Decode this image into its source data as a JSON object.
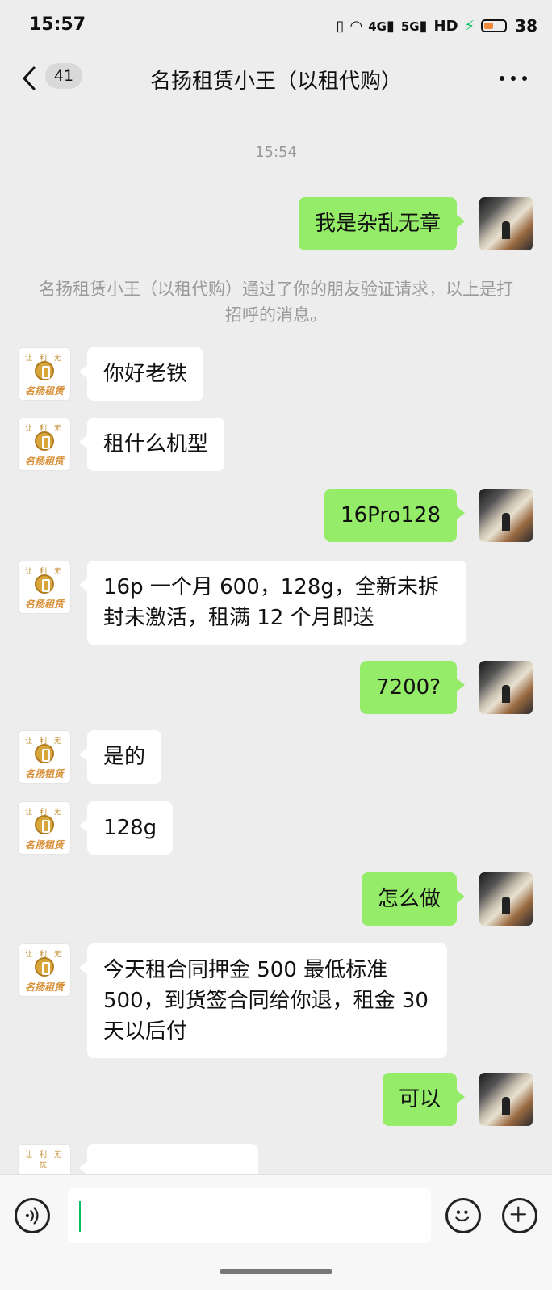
{
  "status_bar": {
    "time": "15:57",
    "network_4g": "4G",
    "network_5g": "5G",
    "hd": "HD",
    "battery": "38"
  },
  "header": {
    "unread_count": "41",
    "title": "名扬租赁小王（以租代购）"
  },
  "chat": {
    "timestamp": "15:54",
    "system_note": "名扬租赁小王（以租代购）通过了你的朋友验证请求，以上是打招呼的消息。",
    "contact_logo_top": "让 利 无 忧",
    "contact_logo_name": "名扬租赁",
    "messages": [
      {
        "from": "me",
        "text": "我是杂乱无章"
      },
      {
        "from": "them",
        "text": "你好老铁"
      },
      {
        "from": "them",
        "text": "租什么机型"
      },
      {
        "from": "me",
        "text": "16Pro128"
      },
      {
        "from": "them",
        "text": "16p 一个月 600，128g，全新未拆封未激活，租满 12 个月即送"
      },
      {
        "from": "me",
        "text": "7200?"
      },
      {
        "from": "them",
        "text": "是的"
      },
      {
        "from": "them",
        "text": "128g"
      },
      {
        "from": "me",
        "text": "怎么做"
      },
      {
        "from": "them",
        "text": "今天租合同押金 500 最低标准 500，到货签合同给你退，租金 30 天以后付"
      },
      {
        "from": "me",
        "text": "可以"
      }
    ]
  },
  "input_bar": {
    "text": ""
  }
}
